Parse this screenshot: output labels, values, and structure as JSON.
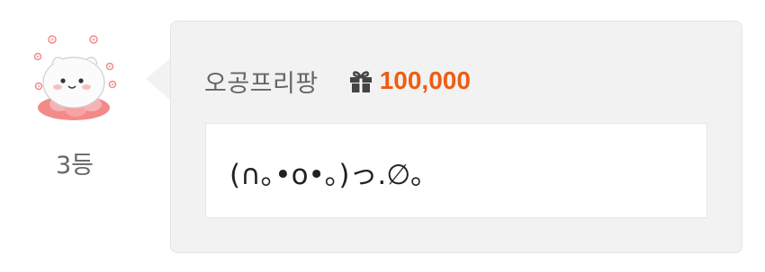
{
  "entry": {
    "rank_label": "3등",
    "username": "오공프리팡",
    "gift_icon": "gift-icon",
    "amount": "100,000",
    "message": "(∩｡•o•｡)っ.∅｡"
  },
  "colors": {
    "amount": "#ee5d12",
    "bubble_bg": "#f2f2f2",
    "message_bg": "#ffffff",
    "muted_text": "#666666"
  }
}
